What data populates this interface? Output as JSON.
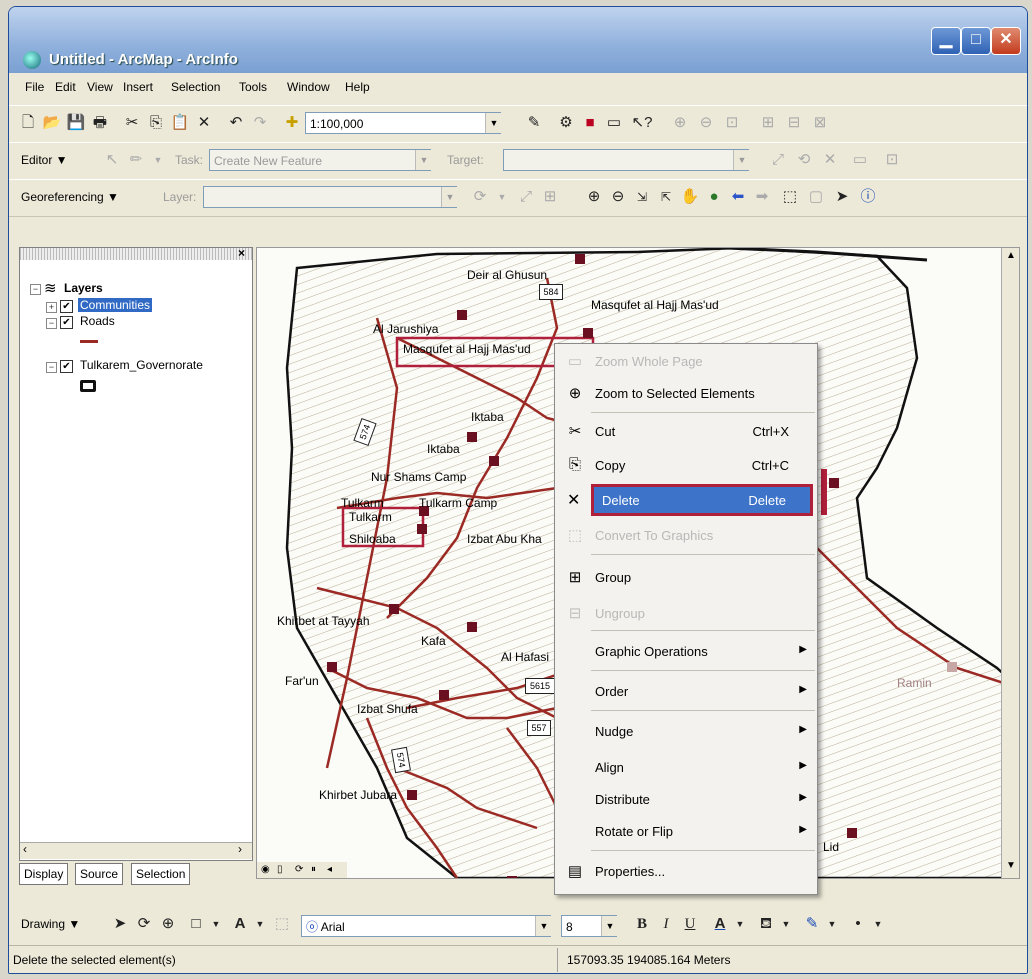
{
  "window": {
    "title": "Untitled - ArcMap - ArcInfo"
  },
  "menubar": {
    "items": [
      "File",
      "Edit",
      "View",
      "Insert",
      "Selection",
      "Tools",
      "Window",
      "Help"
    ]
  },
  "standard_toolbar": {
    "scale_value": "1:100,000"
  },
  "editor_toolbar": {
    "editor_label": "Editor ▼",
    "task_label": "Task:",
    "task_value": "Create New Feature",
    "target_label": "Target:"
  },
  "georef_toolbar": {
    "label": "Georeferencing ▼",
    "layer_label": "Layer:"
  },
  "toc": {
    "layers_heading": "Layers",
    "items": [
      {
        "label": "Communities",
        "selected": true
      },
      {
        "label": "Roads"
      },
      {
        "label": "Tulkarem_Governorate"
      }
    ],
    "tabs": [
      "Display",
      "Source",
      "Selection"
    ]
  },
  "map": {
    "labels": [
      "Deir al Ghusun",
      "Masqufet al Hajj Mas'ud",
      "Al Jarushiya",
      "Masqufet al Hajj Mas'ud",
      "Iktaba",
      "Iktaba",
      "Nur Shams Camp",
      "Tulkarm",
      "Tulkarm Camp",
      "Tulkarm",
      "Shiloaba",
      "Izbat Abu Kha",
      "Khirbet at Tayyah",
      "Kafa",
      "Al Hafasi",
      "Far'un",
      "Izbat Shufa",
      "Khirbet Jubara",
      "Ramin",
      "Lid"
    ],
    "shields": [
      "584",
      "574",
      "574",
      "557",
      "5615"
    ]
  },
  "context_menu": {
    "items": [
      {
        "label": "Zoom Whole Page",
        "icon": "zoom-page-icon",
        "disabled": true
      },
      {
        "label": "Zoom to Selected Elements",
        "icon": "zoom-selected-icon"
      },
      {
        "label": "Cut",
        "shortcut": "Ctrl+X",
        "icon": "scissors-icon"
      },
      {
        "label": "Copy",
        "shortcut": "Ctrl+C",
        "icon": "copy-icon"
      },
      {
        "label": "Delete",
        "shortcut": "Delete",
        "icon": "delete-x-icon",
        "highlighted": true
      },
      {
        "label": "Convert To Graphics",
        "icon": "convert-icon",
        "disabled": true
      },
      {
        "label": "Group",
        "icon": "group-icon"
      },
      {
        "label": "Ungroup",
        "icon": "ungroup-icon",
        "disabled": true
      },
      {
        "label": "Graphic Operations",
        "submenu": true
      },
      {
        "label": "Order",
        "submenu": true
      },
      {
        "label": "Nudge",
        "submenu": true
      },
      {
        "label": "Align",
        "submenu": true
      },
      {
        "label": "Distribute",
        "submenu": true
      },
      {
        "label": "Rotate or Flip",
        "submenu": true
      },
      {
        "label": "Properties...",
        "icon": "properties-icon"
      }
    ]
  },
  "drawing_toolbar": {
    "label": "Drawing ▼",
    "font_value": "Arial",
    "size_value": "8"
  },
  "status_bar": {
    "message": "Delete the selected element(s)",
    "coordinates": "157093.35  194085.164 Meters"
  },
  "colors": {
    "selection": "#3d74c9",
    "road": "#9b2a24",
    "point": "#6b1020",
    "highlight_box": "#b0203a"
  }
}
